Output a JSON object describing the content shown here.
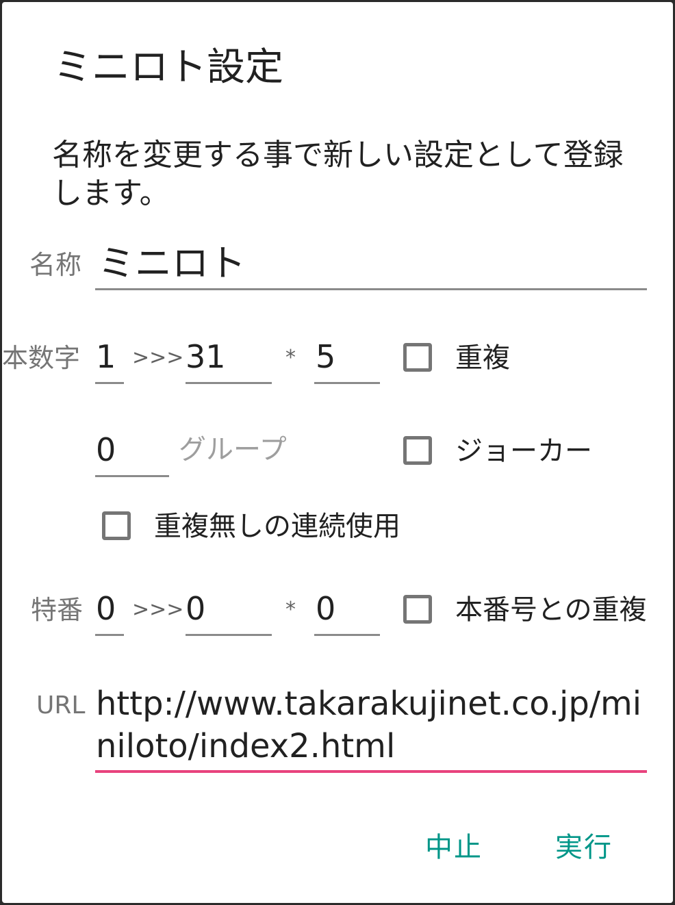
{
  "dialog": {
    "title": "ミニロト設定",
    "message": "名称を変更する事で新しい設定として登録します。"
  },
  "fields": {
    "name": {
      "label": "名称",
      "value": "ミニロト"
    },
    "main": {
      "label": "本数字",
      "from": "1",
      "arrow": ">>>",
      "to": "31",
      "times": "*",
      "count": "5"
    },
    "main_duplicate": {
      "label": "重複",
      "checked": false
    },
    "group": {
      "value": "0",
      "label": "グループ"
    },
    "joker": {
      "label": "ジョーカー",
      "checked": false
    },
    "consecutive": {
      "label": "重複無しの連続使用",
      "checked": false
    },
    "special": {
      "label": "特番",
      "from": "0",
      "arrow": ">>>",
      "to": "0",
      "times": "*",
      "count": "0"
    },
    "special_duplicate": {
      "label": "本番号との重複",
      "checked": false
    },
    "url": {
      "label": "URL",
      "value": "http://www.takarakujinet.co.jp/miniloto/index2.html"
    }
  },
  "buttons": {
    "cancel": "中止",
    "execute": "実行"
  },
  "colors": {
    "accent": "#009688",
    "focus_underline": "#e8437d"
  }
}
